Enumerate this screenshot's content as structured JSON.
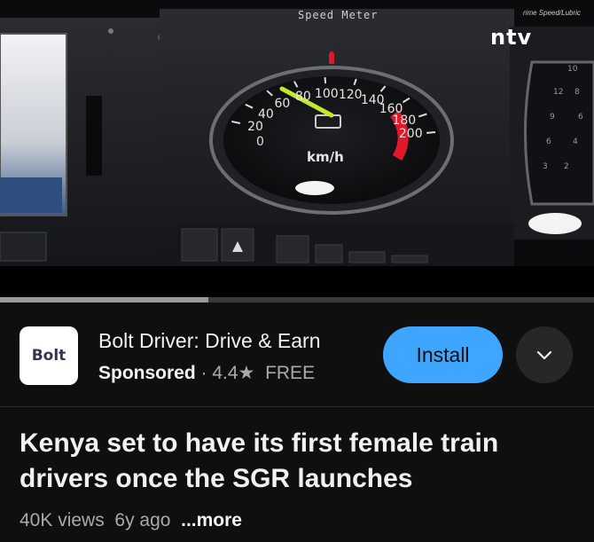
{
  "video": {
    "overlay_label": "Speed Meter",
    "channel_logo": "ntv",
    "channel_ticker": "rime Speed/Lubric",
    "gauge_unit": "km/h",
    "gauge_ticks": [
      "20",
      "40",
      "60",
      "80",
      "100",
      "120",
      "140",
      "160",
      "180",
      "200"
    ],
    "gauge_zero": "0",
    "progress_fraction": 0.35
  },
  "ad": {
    "app_icon_text": "Bolt",
    "app_title": "Bolt Driver: Drive & Earn",
    "sponsored": "Sponsored",
    "separator": " · ",
    "rating": "4.4★",
    "price": "FREE",
    "install_label": "Install",
    "expand_icon": "chevron-down-icon"
  },
  "video_info": {
    "title": "Kenya set to have its first female train drivers once the SGR launches",
    "views": "40K views",
    "age": "6y ago",
    "more": "...more"
  },
  "colors": {
    "accent": "#3ea6ff",
    "background": "#0f0f0f",
    "needle": "#c6e82a",
    "redline": "#e0182b"
  }
}
